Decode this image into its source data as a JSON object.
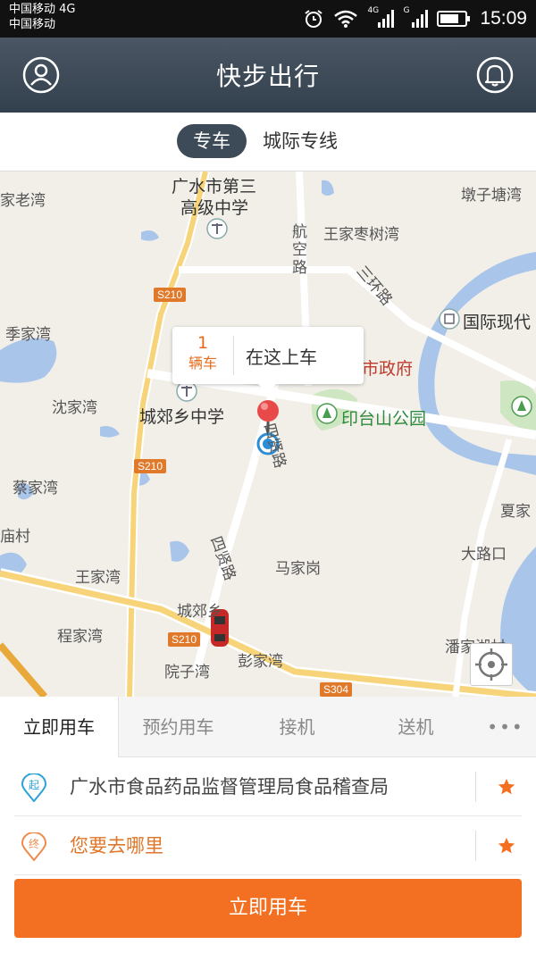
{
  "status_bar": {
    "carrier_line1": "中国移动 4G",
    "carrier_line2": "中国移动",
    "network_1": "4G",
    "network_2": "G",
    "time": "15:09"
  },
  "header": {
    "title": "快步出行",
    "left_icon": "user-icon",
    "right_icon": "bell-icon"
  },
  "mode_tabs": [
    {
      "label": "专车",
      "active": true
    },
    {
      "label": "城际专线",
      "active": false
    }
  ],
  "map": {
    "labels": [
      "家老湾",
      "广水市第三",
      "高级中学",
      "墩子塘湾",
      "航空路",
      "王家枣树湾",
      "三环路",
      "国际现代",
      "季家湾",
      "市政府",
      "沈家湾",
      "城郊乡中学",
      "印台山公园",
      "四贤路",
      "蔡家湾",
      "夏家",
      "庙村",
      "大路口",
      "王家湾",
      "马家岗",
      "四贤路",
      "城郊乡",
      "程家湾",
      "潘家湖村",
      "院子湾",
      "彭家湾"
    ],
    "road_tags": [
      "S210",
      "S210",
      "S210",
      "S304"
    ],
    "pickup_bubble": {
      "car_count": "1",
      "car_unit": "辆车",
      "text": "在这上车"
    }
  },
  "service_tabs": [
    {
      "label": "立即用车",
      "active": true
    },
    {
      "label": "预约用车",
      "active": false
    },
    {
      "label": "接机",
      "active": false
    },
    {
      "label": "送机",
      "active": false
    },
    {
      "label": "•••",
      "active": false
    }
  ],
  "origin": {
    "icon_label": "起",
    "value": "广水市食品药品监督管理局食品稽查局"
  },
  "destination": {
    "icon_label": "终",
    "placeholder": "您要去哪里"
  },
  "call_button": "立即用车",
  "colors": {
    "accent_orange": "#f36f21",
    "origin_blue": "#2aa2d8",
    "header_dark": "#3d4a57"
  }
}
